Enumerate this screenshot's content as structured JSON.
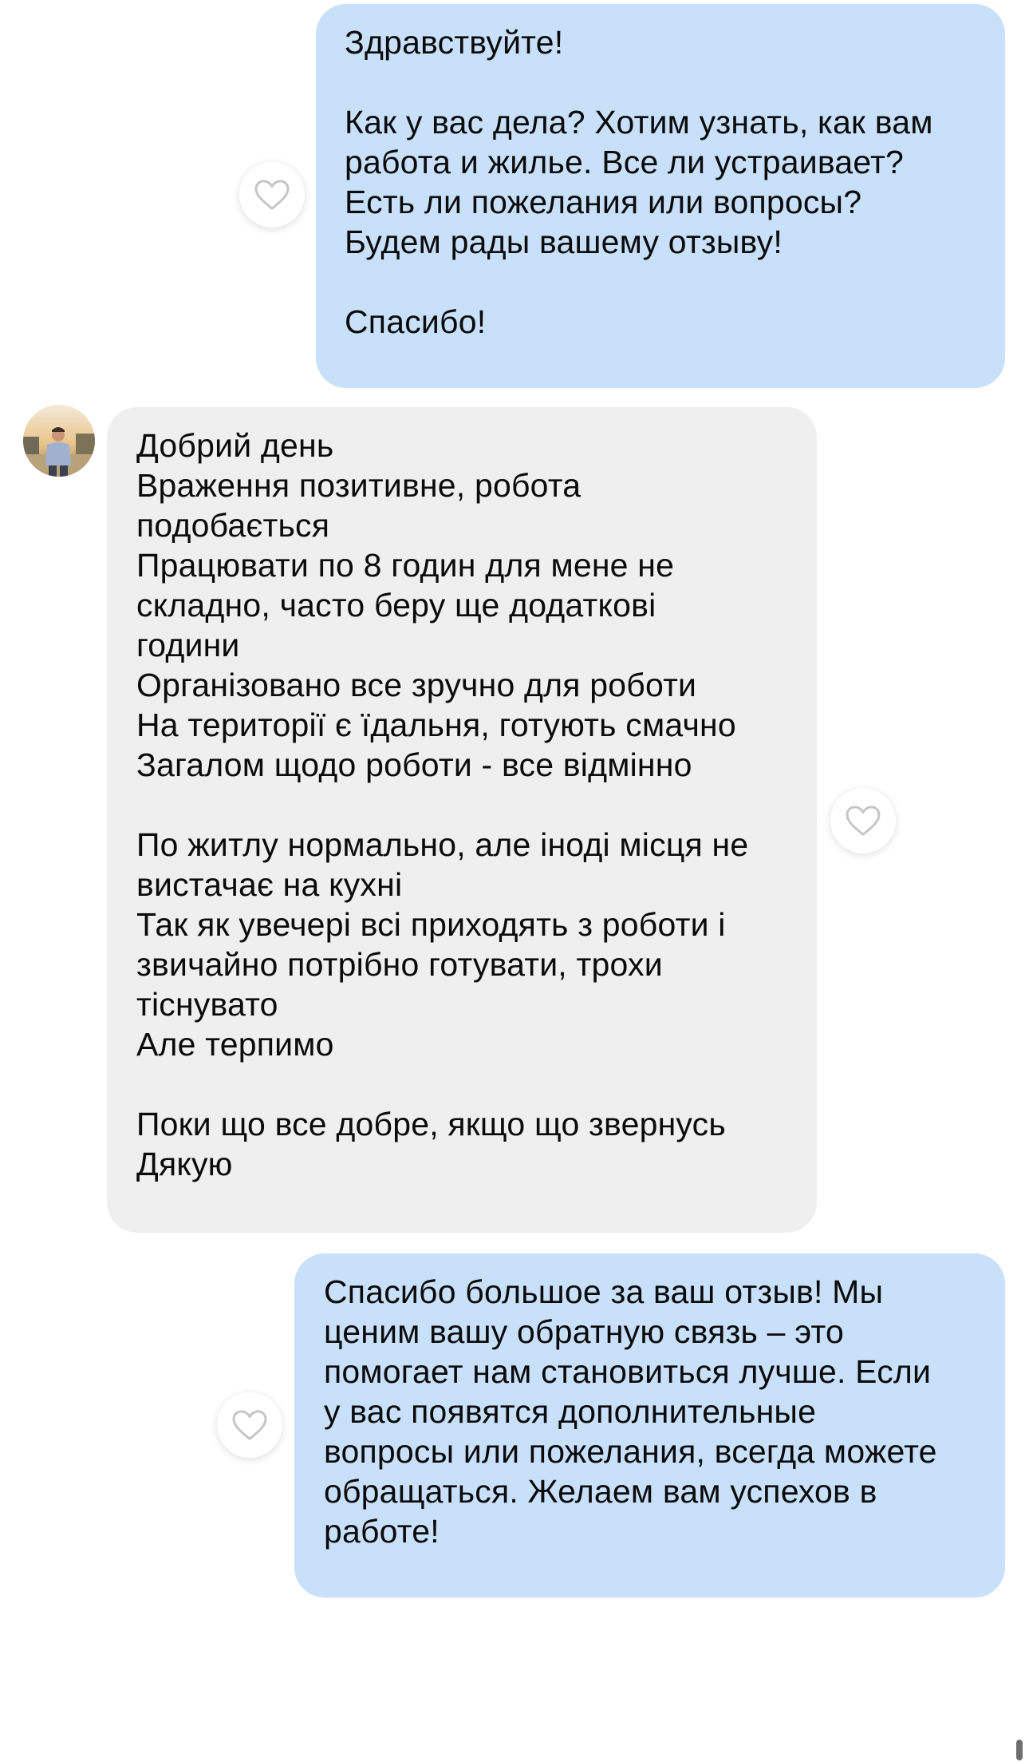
{
  "messages": [
    {
      "direction": "outgoing",
      "text": "Здравствуйте!\n\nКак у вас дела? Хотим узнать, как вам\nработа и жилье. Все ли устраивает?\nЕсть ли пожелания или вопросы?\nБудем рады вашему отзыву!\n\nСпасибо!"
    },
    {
      "direction": "incoming",
      "text": "Добрий день\nВраження позитивне, робота\nподобається\nПрацювати по 8 годин для мене не\nскладно, часто беру ще додаткові\nгодини\nОрганізовано все зручно для роботи\nНа території є їдальня, готують смачно\nЗагалом щодо роботи - все відмінно\n\nПо житлу нормально, але іноді місця не\nвистачає на кухні\nТак як увечері всі приходять з роботи і\nзвичайно потрібно готувати, трохи\nтіснувато\nАле терпимо\n\nПоки що все добре, якщо що звернусь\nДякую"
    },
    {
      "direction": "outgoing",
      "text": "Спасибо большое за ваш отзыв! Мы\nценим вашу обратную связь – это\nпомогает нам становиться лучше. Если\nу вас появятся дополнительные\nвопросы или пожелания, всегда можете\nобращаться. Желаем вам успехов в\nработе!"
    }
  ],
  "icons": {
    "like": "heart-outline-icon",
    "avatar": "user-avatar-photo"
  },
  "colors": {
    "outgoing_bubble": "#c9e0fb",
    "incoming_bubble": "#efefef",
    "heart_stroke": "#c6c6c6",
    "background": "#ffffff"
  }
}
